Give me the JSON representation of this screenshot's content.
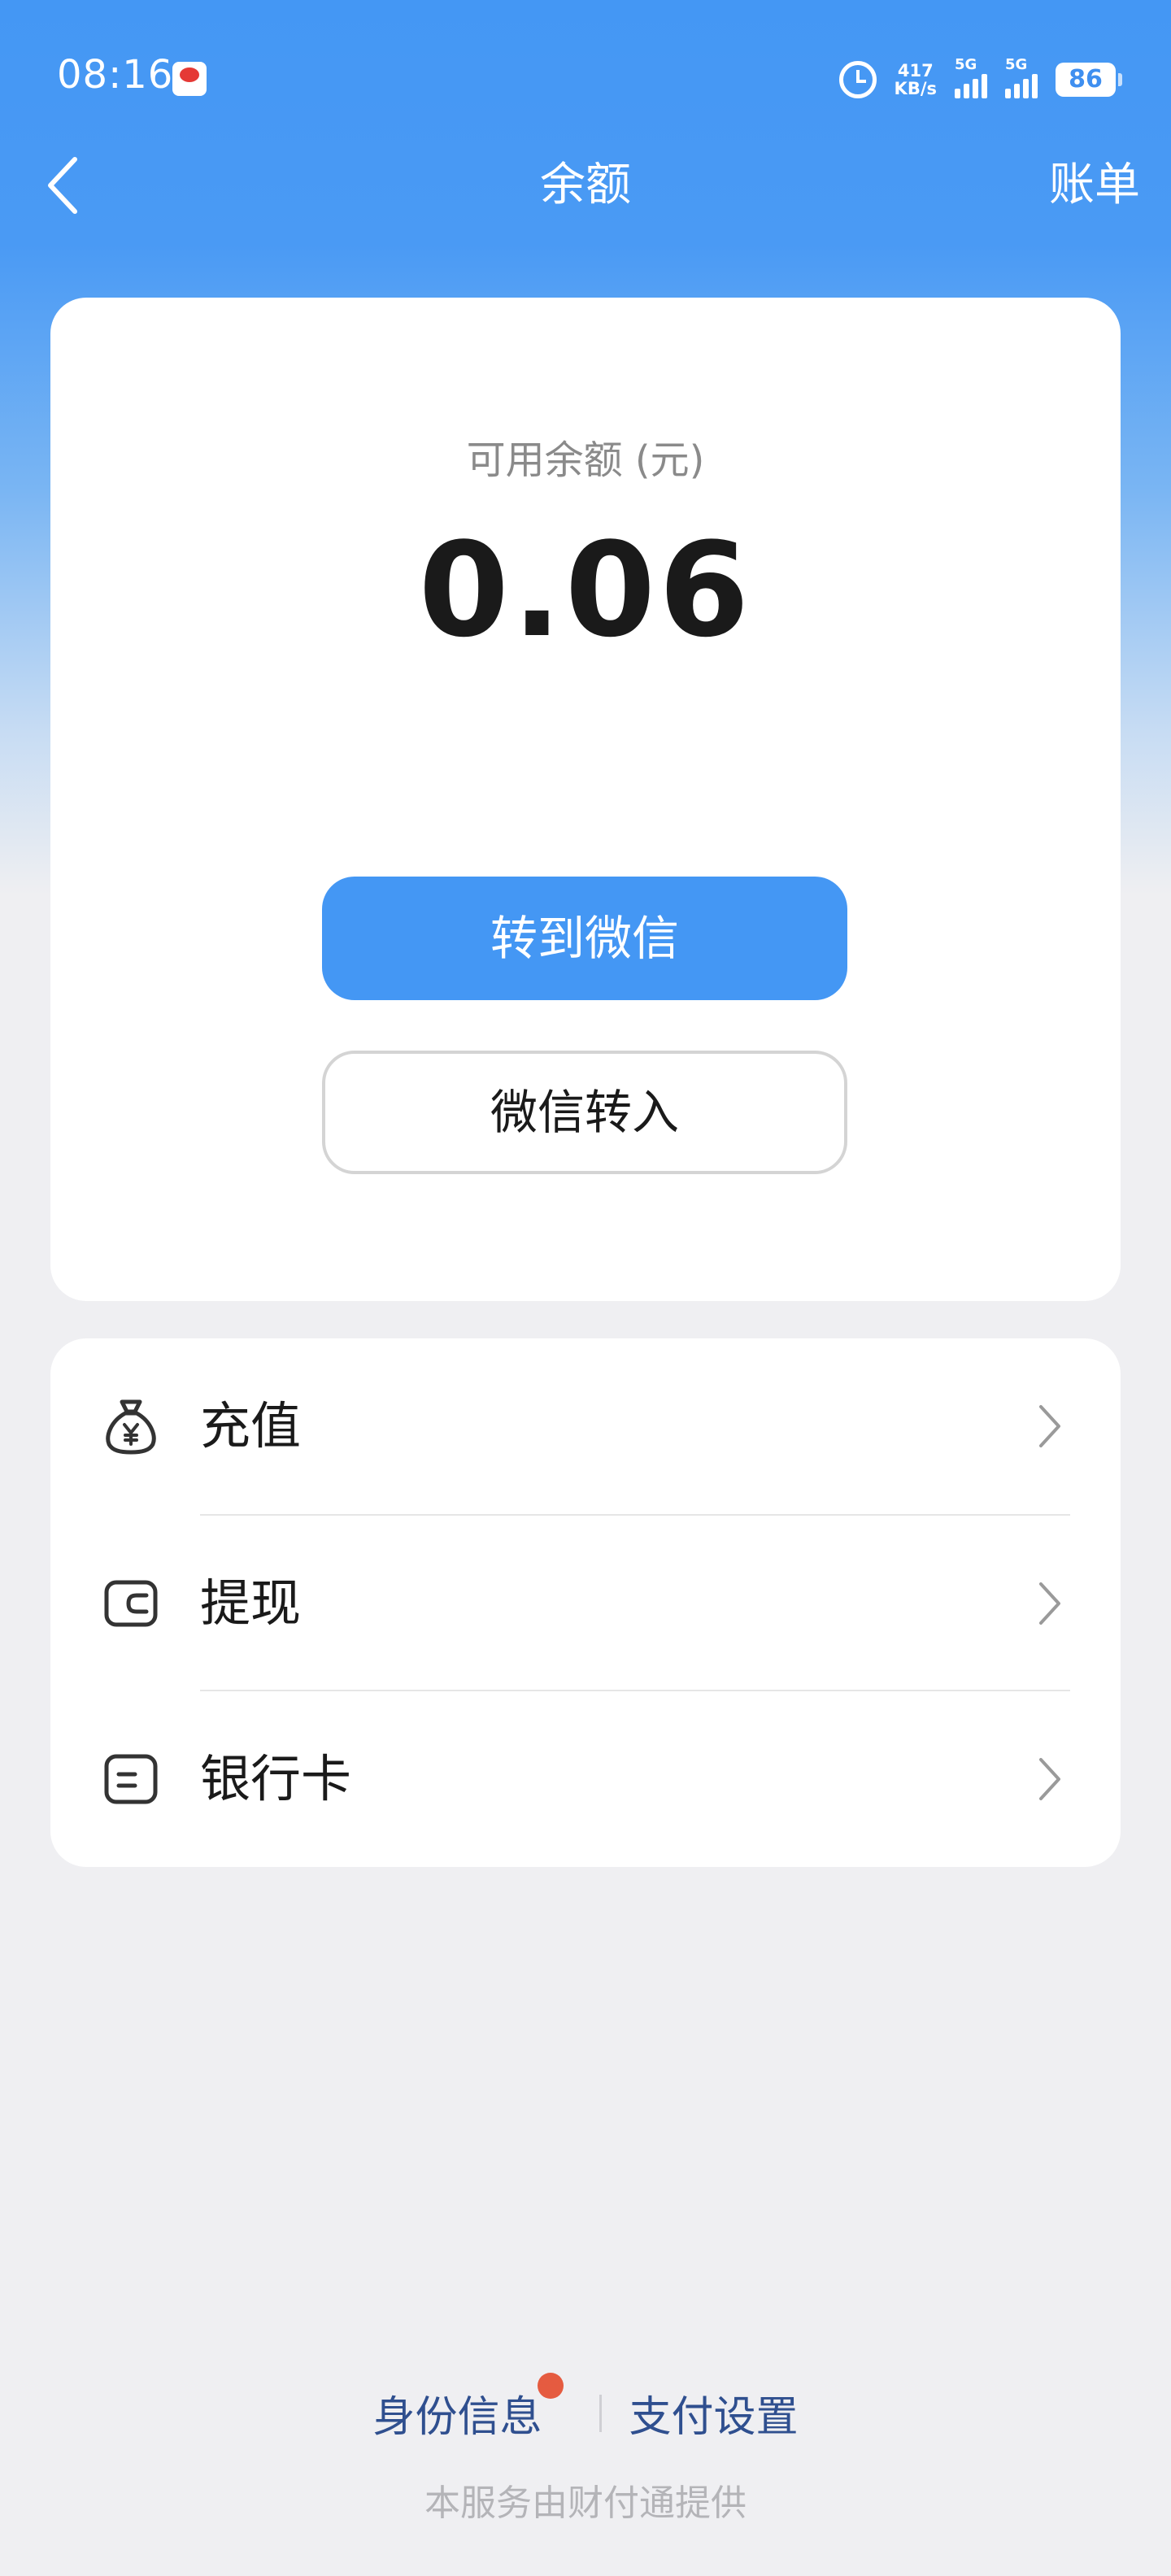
{
  "status_bar": {
    "time": "08:16",
    "speed_value": "417",
    "speed_unit": "KB/s",
    "sim1_tag": "5G",
    "sim2_tag": "5G",
    "battery": "86"
  },
  "nav": {
    "title": "余额",
    "right_action": "账单",
    "back_icon": "chevron-left-icon"
  },
  "balance": {
    "label": "可用余额 (元)",
    "amount": "0.06",
    "primary_button": "转到微信",
    "secondary_button": "微信转入"
  },
  "menu": {
    "items": [
      {
        "label": "充值",
        "icon": "money-bag-icon"
      },
      {
        "label": "提现",
        "icon": "wallet-icon"
      },
      {
        "label": "银行卡",
        "icon": "bank-card-icon"
      }
    ]
  },
  "footer": {
    "identity_link": "身份信息",
    "payment_settings_link": "支付设置",
    "provider_text": "本服务由财付通提供"
  },
  "colors": {
    "accent": "#4497f4",
    "link": "#2f4f8f",
    "notification_dot": "#e55b40"
  }
}
